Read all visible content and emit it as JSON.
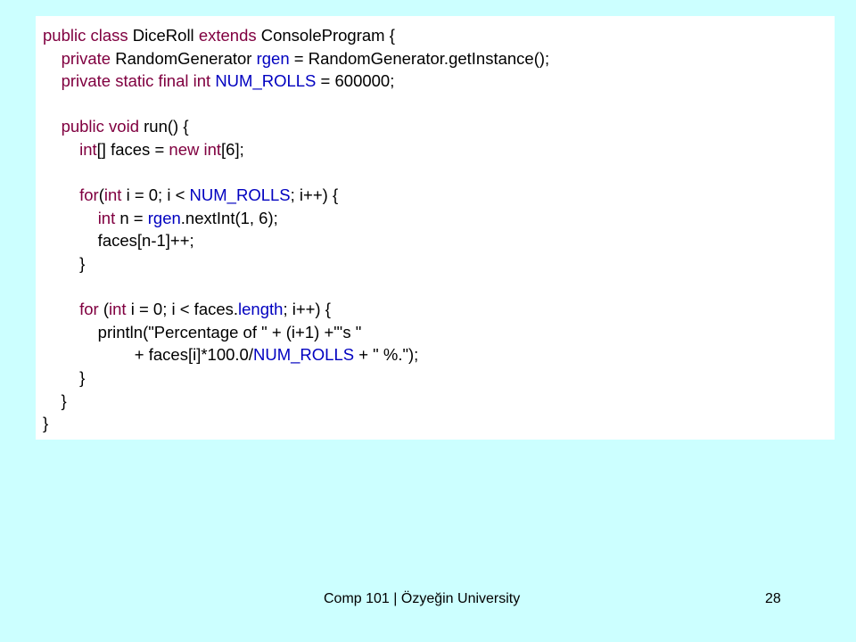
{
  "colors": {
    "background": "#ccffff",
    "code_background": "#ffffff",
    "keyword": "#800040",
    "field": "#0000c0",
    "text": "#000000"
  },
  "code": {
    "lines": [
      [
        {
          "t": "public class",
          "k": "kw"
        },
        {
          "t": " DiceRoll "
        },
        {
          "t": "extends",
          "k": "kw"
        },
        {
          "t": " ConsoleProgram {"
        }
      ],
      [
        {
          "t": "    "
        },
        {
          "t": "private",
          "k": "kw"
        },
        {
          "t": " RandomGenerator "
        },
        {
          "t": "rgen",
          "k": "fld"
        },
        {
          "t": " = RandomGenerator.getInstance();"
        }
      ],
      [
        {
          "t": "    "
        },
        {
          "t": "private static final int",
          "k": "kw"
        },
        {
          "t": " "
        },
        {
          "t": "NUM_ROLLS",
          "k": "fld"
        },
        {
          "t": " = 600000;"
        }
      ],
      [],
      [
        {
          "t": "    "
        },
        {
          "t": "public void",
          "k": "kw"
        },
        {
          "t": " run() {"
        }
      ],
      [
        {
          "t": "        "
        },
        {
          "t": "int",
          "k": "kw"
        },
        {
          "t": "[] faces = "
        },
        {
          "t": "new int",
          "k": "kw"
        },
        {
          "t": "[6];"
        }
      ],
      [],
      [
        {
          "t": "        "
        },
        {
          "t": "for",
          "k": "kw"
        },
        {
          "t": "("
        },
        {
          "t": "int",
          "k": "kw"
        },
        {
          "t": " i = 0; i < "
        },
        {
          "t": "NUM_ROLLS",
          "k": "fld"
        },
        {
          "t": "; i++) {"
        }
      ],
      [
        {
          "t": "            "
        },
        {
          "t": "int",
          "k": "kw"
        },
        {
          "t": " n = "
        },
        {
          "t": "rgen",
          "k": "fld"
        },
        {
          "t": ".nextInt(1, 6);"
        }
      ],
      [
        {
          "t": "            faces[n-1]++;"
        }
      ],
      [
        {
          "t": "        }"
        }
      ],
      [],
      [
        {
          "t": "        "
        },
        {
          "t": "for",
          "k": "kw"
        },
        {
          "t": " ("
        },
        {
          "t": "int",
          "k": "kw"
        },
        {
          "t": " i = 0; i < faces."
        },
        {
          "t": "length",
          "k": "fld"
        },
        {
          "t": "; i++) {"
        }
      ],
      [
        {
          "t": "            println(\"Percentage of \" + (i+1) +\"'s \""
        }
      ],
      [
        {
          "t": "                    + faces[i]*100.0/"
        },
        {
          "t": "NUM_ROLLS",
          "k": "fld"
        },
        {
          "t": " + \" %.\");"
        }
      ],
      [
        {
          "t": "        }"
        }
      ],
      [
        {
          "t": "    }"
        }
      ],
      [
        {
          "t": "}"
        }
      ]
    ]
  },
  "footer": {
    "title": "Comp 101 | Özyeğin University",
    "page_number": "28"
  }
}
